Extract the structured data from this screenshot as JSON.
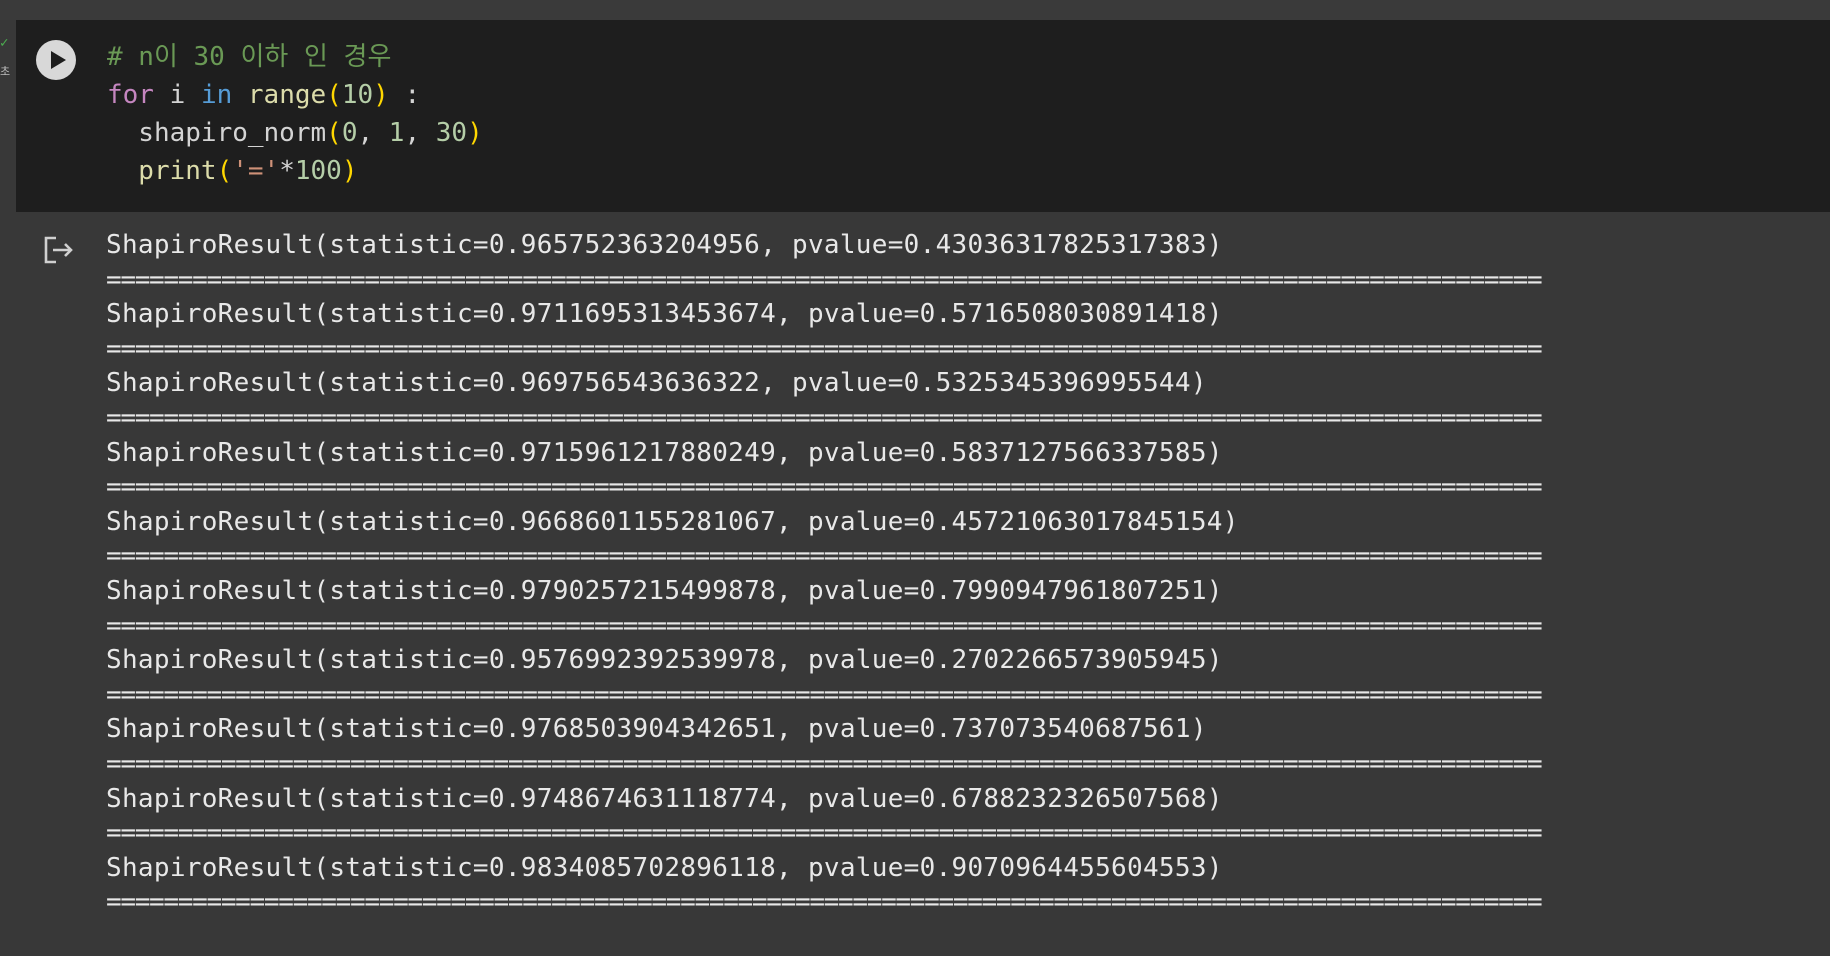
{
  "cell": {
    "execution_status_check": "✓",
    "execution_time_fragment": "초",
    "code_lines": [
      [
        {
          "t": "# n이 30 이하 인 경우",
          "c": "c-comment"
        }
      ],
      [
        {
          "t": "for",
          "c": "c-kw-for"
        },
        {
          "t": " i ",
          "c": "c-plain"
        },
        {
          "t": "in",
          "c": "c-kw-in"
        },
        {
          "t": " ",
          "c": "c-plain"
        },
        {
          "t": "range",
          "c": "c-func"
        },
        {
          "t": "(",
          "c": "c-paren"
        },
        {
          "t": "10",
          "c": "c-num"
        },
        {
          "t": ")",
          "c": "c-paren"
        },
        {
          "t": " :",
          "c": "c-plain"
        }
      ],
      [
        {
          "t": "  shapiro_norm",
          "c": "c-plain"
        },
        {
          "t": "(",
          "c": "c-paren"
        },
        {
          "t": "0",
          "c": "c-num"
        },
        {
          "t": ", ",
          "c": "c-plain"
        },
        {
          "t": "1",
          "c": "c-num"
        },
        {
          "t": ", ",
          "c": "c-plain"
        },
        {
          "t": "30",
          "c": "c-num"
        },
        {
          "t": ")",
          "c": "c-paren"
        }
      ],
      [
        {
          "t": "  print",
          "c": "c-func"
        },
        {
          "t": "(",
          "c": "c-paren"
        },
        {
          "t": "'='",
          "c": "c-str"
        },
        {
          "t": "*",
          "c": "c-plain"
        },
        {
          "t": "100",
          "c": "c-num"
        },
        {
          "t": ")",
          "c": "c-paren"
        }
      ]
    ],
    "icons": {
      "run": "play-icon",
      "output": "output-redirect-icon"
    }
  },
  "output": {
    "separator": "====================================================================================================",
    "results": [
      "ShapiroResult(statistic=0.965752363204956, pvalue=0.43036317825317383)",
      "ShapiroResult(statistic=0.9711695313453674, pvalue=0.5716508030891418)",
      "ShapiroResult(statistic=0.969756543636322, pvalue=0.5325345396995544)",
      "ShapiroResult(statistic=0.9715961217880249, pvalue=0.5837127566337585)",
      "ShapiroResult(statistic=0.9668601155281067, pvalue=0.45721063017845154)",
      "ShapiroResult(statistic=0.9790257215499878, pvalue=0.7990947961807251)",
      "ShapiroResult(statistic=0.9576992392539978, pvalue=0.2702266573905945)",
      "ShapiroResult(statistic=0.9768503904342651, pvalue=0.737073540687561)",
      "ShapiroResult(statistic=0.9748674631118774, pvalue=0.6788232326507568)",
      "ShapiroResult(statistic=0.9834085702896118, pvalue=0.9070964455604553)"
    ]
  },
  "colors": {
    "cell_background": "#1e1e1e",
    "page_background": "#383838",
    "comment": "#6a9955",
    "keyword_for": "#c586c0",
    "keyword_in": "#569cd6",
    "function": "#dcdcaa",
    "number": "#b5cea8",
    "string": "#ce9178",
    "bracket": "#ffd700",
    "output_text": "#e8e8e8"
  }
}
